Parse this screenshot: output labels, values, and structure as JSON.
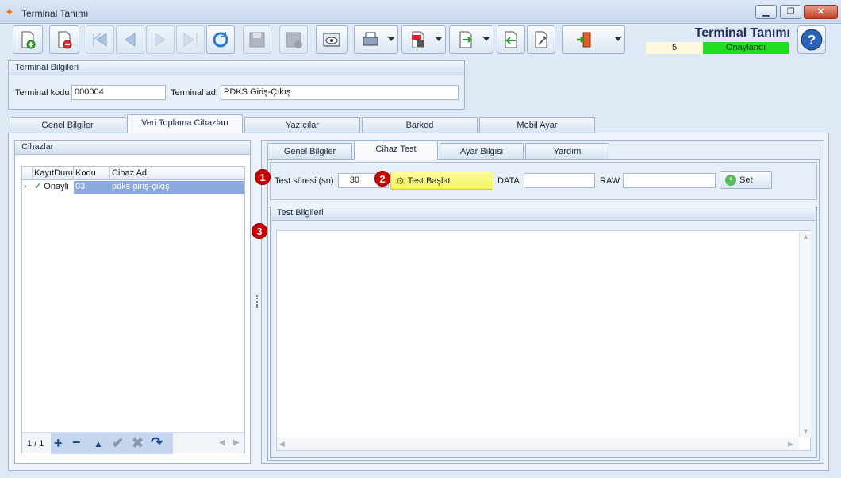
{
  "window": {
    "title": "Terminal Tanımı",
    "min_icon": "minimize-icon",
    "max_icon": "maximize-icon",
    "close_icon": "close-icon"
  },
  "toolbar": {
    "form_title": "Terminal Tanımı",
    "record_count": "5",
    "status": "Onaylandı",
    "status_color": "#22dd22",
    "buttons": [
      "new-record-icon",
      "delete-record-icon",
      "first-record-icon",
      "previous-record-icon",
      "next-record-icon",
      "last-record-icon",
      "refresh-icon",
      "save-icon",
      "save-close-icon",
      "preview-icon",
      "print-icon",
      "pdf-export-icon",
      "export-icon",
      "import-icon",
      "settings-icon",
      "exit-icon",
      "help-icon"
    ]
  },
  "terminal_info": {
    "header": "Terminal Bilgileri",
    "code_label": "Terminal kodu",
    "code_value": "000004",
    "name_label": "Terminal adı",
    "name_value": "PDKS Giriş-Çıkış"
  },
  "main_tabs": [
    {
      "label": "Genel Bilgiler"
    },
    {
      "label": "Veri Toplama Cihazları"
    },
    {
      "label": "Yazıcılar"
    },
    {
      "label": "Barkod"
    },
    {
      "label": "Mobil Ayar"
    }
  ],
  "devices": {
    "header": "Cihazlar",
    "columns": [
      "KayıtDurumu",
      "Kodu",
      "Cihaz Adı"
    ],
    "rows": [
      {
        "status": "Onaylı",
        "code": "03",
        "name": "pdks giriş-çıkış"
      }
    ],
    "pager": "1 / 1"
  },
  "sub_tabs": [
    {
      "label": "Genel Bilgiler"
    },
    {
      "label": "Cihaz Test"
    },
    {
      "label": "Ayar Bilgisi"
    },
    {
      "label": "Yardım"
    }
  ],
  "test": {
    "duration_label": "Test süresi (sn)",
    "duration_value": "30",
    "start_button": "Test Başlat",
    "data_label": "DATA",
    "data_value": "",
    "raw_label": "RAW",
    "raw_value": "",
    "set_button": "Set",
    "info_header": "Test Bilgileri"
  },
  "markers": [
    "1",
    "2",
    "3"
  ]
}
